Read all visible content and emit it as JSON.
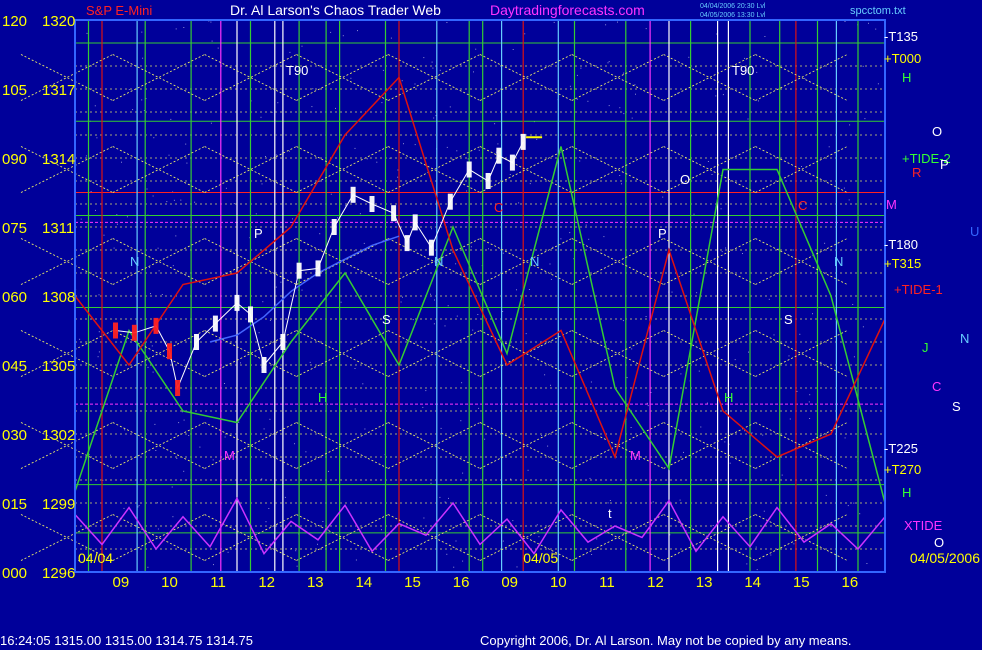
{
  "header": {
    "instrument": "S&P E-Mini",
    "title": "Dr. Al Larson's Chaos Trader Web",
    "site": "Daytradingforecasts.com",
    "stamp1": "04/04/2006 20:30 Lvl",
    "stamp2": "04/05/2006 13:30 Lvl",
    "filename": "spcctom.txt"
  },
  "colors": {
    "background": "#00009a",
    "grid": "#ffff66",
    "price": "#ffffff",
    "green_curve": "#33cc33",
    "red_curve": "#dd1111",
    "xtide": "#cc33ff",
    "blue_curve": "#4466ff",
    "text_yellow": "#ffff00",
    "text_magenta": "#ff33ff"
  },
  "footer": {
    "quote": "16:24:05  1315.00 1315.00 1314.75 1314.75",
    "copyright": "Copyright 2006, Dr. Al Larson. May not be copied by any means."
  },
  "chart_data": {
    "type": "line",
    "title": "Dr. Al Larson's Chaos Trader Web",
    "y_price_ticks": [
      "1320",
      "1317",
      "1314",
      "1311",
      "1308",
      "1305",
      "1302",
      "1299",
      "1296"
    ],
    "y_angle_ticks": [
      "120",
      "105",
      "090",
      "075",
      "060",
      "045",
      "030",
      "015",
      "000"
    ],
    "ylim": [
      1296,
      1320
    ],
    "x_ticks": [
      "09",
      "10",
      "11",
      "12",
      "13",
      "14",
      "15",
      "16",
      "09",
      "10",
      "11",
      "12",
      "13",
      "14",
      "15",
      "16"
    ],
    "date_labels": [
      "04/04",
      "04/05",
      "04/05/2006"
    ],
    "right_labels": [
      {
        "text": "-T135",
        "color": "#ffffff"
      },
      {
        "text": "+T000",
        "color": "#ffff00"
      },
      {
        "text": "H",
        "color": "#33ff33"
      },
      {
        "text": "O",
        "color": "#ffffff"
      },
      {
        "text": "+TIDE-2",
        "color": "#33ff33"
      },
      {
        "text": "P",
        "color": "#ffffff"
      },
      {
        "text": "R",
        "color": "#ff2222"
      },
      {
        "text": "M",
        "color": "#ff33ff"
      },
      {
        "text": "-T180",
        "color": "#ffffff"
      },
      {
        "text": "+T315",
        "color": "#ffff00"
      },
      {
        "text": "+TIDE-1",
        "color": "#ff2222"
      },
      {
        "text": "U",
        "color": "#3366ff"
      },
      {
        "text": "N",
        "color": "#66ccff"
      },
      {
        "text": "J",
        "color": "#33ff33"
      },
      {
        "text": "C",
        "color": "#ff33ff"
      },
      {
        "text": "S",
        "color": "#ffffff"
      },
      {
        "text": "-T225",
        "color": "#ffffff"
      },
      {
        "text": "+T270",
        "color": "#ffff00"
      },
      {
        "text": "H",
        "color": "#33ff33"
      },
      {
        "text": "XTIDE",
        "color": "#ff33ff"
      },
      {
        "text": "O",
        "color": "#ffffff"
      }
    ],
    "markers": [
      {
        "text": "T90",
        "color": "#ffffff"
      },
      {
        "text": "T90",
        "color": "#ffffff"
      },
      {
        "text": "N",
        "color": "#66ccff"
      },
      {
        "text": "N",
        "color": "#66ccff"
      },
      {
        "text": "N",
        "color": "#66ccff"
      },
      {
        "text": "N",
        "color": "#66ccff"
      },
      {
        "text": "P",
        "color": "#ffffff"
      },
      {
        "text": "P",
        "color": "#ffffff"
      },
      {
        "text": "O",
        "color": "#ffffff"
      },
      {
        "text": "C",
        "color": "#ff2222"
      },
      {
        "text": "C",
        "color": "#ff2222"
      },
      {
        "text": "S",
        "color": "#ffffff"
      },
      {
        "text": "S",
        "color": "#ffffff"
      },
      {
        "text": "M",
        "color": "#ff33ff"
      },
      {
        "text": "M",
        "color": "#ff33ff"
      },
      {
        "text": "H",
        "color": "#33ff33"
      },
      {
        "text": "H",
        "color": "#33ff33"
      },
      {
        "text": "t",
        "color": "#ffffff"
      }
    ],
    "series": [
      {
        "name": "price",
        "color": "#ffffff",
        "x": [
          1.5,
          2.2,
          3.0,
          3.5,
          3.8,
          4.5,
          5.2,
          6.0,
          6.5,
          7.0,
          7.7,
          8.3,
          9.0,
          9.6,
          10.3,
          11.0,
          11.8,
          12.3,
          12.6,
          13.2,
          13.9,
          14.6,
          15.3,
          15.7,
          16.2,
          16.6
        ],
        "y": [
          1306.5,
          1306.4,
          1306.7,
          1305.6,
          1304.0,
          1306.0,
          1306.8,
          1307.7,
          1307.2,
          1305.0,
          1306.0,
          1309.1,
          1309.2,
          1311.0,
          1312.4,
          1312.0,
          1311.6,
          1310.3,
          1311.2,
          1310.1,
          1312.1,
          1313.5,
          1313.0,
          1314.1,
          1313.8,
          1314.7
        ]
      },
      {
        "name": "",
        "color": "#33cc33",
        "x": [
          0,
          2,
          4,
          6,
          8,
          10,
          12,
          14,
          16,
          18,
          20,
          22,
          24,
          26,
          28,
          30
        ],
        "y": [
          1299.5,
          1306.5,
          1303.0,
          1302.5,
          1306.0,
          1309.0,
          1305.0,
          1311.0,
          1305.5,
          1314.5,
          1304.0,
          1300.5,
          1313.5,
          1313.5,
          1308.0,
          1299.0
        ]
      },
      {
        "name": "",
        "color": "#dd1111",
        "x": [
          0,
          2,
          4,
          6,
          8,
          10,
          12,
          14,
          16,
          18,
          20,
          22,
          24,
          26,
          28,
          30
        ],
        "y": [
          1308.0,
          1305.0,
          1308.5,
          1309.0,
          1311.0,
          1315.0,
          1317.5,
          1310.0,
          1305.0,
          1306.5,
          1301.0,
          1310.0,
          1303.0,
          1301.0,
          1302.0,
          1307.0
        ]
      },
      {
        "name": "XTIDE",
        "color": "#cc33ff",
        "x": [
          0,
          1,
          2,
          3,
          4,
          5,
          6,
          7,
          8,
          9,
          10,
          11,
          12,
          13,
          14,
          15,
          16,
          17,
          18,
          19,
          20,
          21,
          22,
          23,
          24,
          25,
          26,
          27,
          28,
          29,
          30
        ],
        "y": [
          1298.5,
          1297.2,
          1298.8,
          1297.0,
          1298.4,
          1297.1,
          1299.2,
          1296.8,
          1298.2,
          1297.4,
          1298.9,
          1296.9,
          1298.1,
          1297.6,
          1299.0,
          1297.2,
          1298.3,
          1296.8,
          1298.7,
          1297.3,
          1298.0,
          1297.5,
          1299.1,
          1296.9,
          1298.4,
          1297.1,
          1298.8,
          1297.3,
          1298.1,
          1297.0,
          1298.4
        ]
      },
      {
        "name": "",
        "color": "#4466ff",
        "x": [
          5.0,
          6.0,
          7.0,
          8.0,
          9.0,
          10.0,
          11.0,
          12.0
        ],
        "y": [
          1306.0,
          1306.3,
          1307.1,
          1308.2,
          1309.0,
          1309.6,
          1310.2,
          1310.6
        ]
      }
    ]
  }
}
